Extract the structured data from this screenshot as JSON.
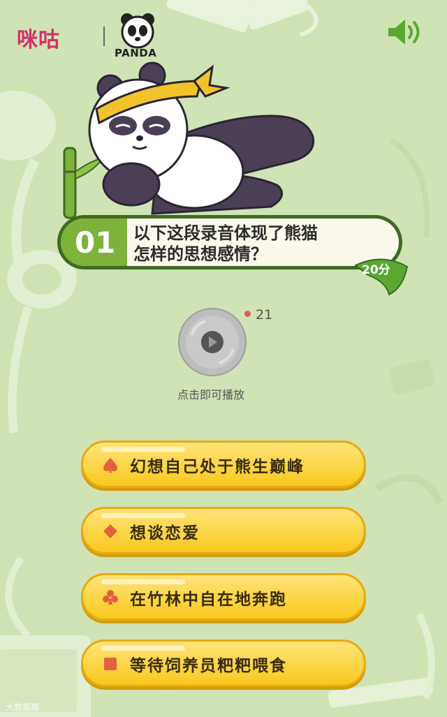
{
  "brand": {
    "migu": "咪咕",
    "panda": "PANDA"
  },
  "question": {
    "number": "01",
    "line1": "以下这段录音体现了熊猫",
    "line2": "怎样的思想感情？",
    "score": "20分"
  },
  "audio": {
    "countdown": "21",
    "hint": "点击即可播放"
  },
  "options": [
    {
      "suit": "spade-icon",
      "label": "幻想自己处于熊生巅峰"
    },
    {
      "suit": "diamond-icon",
      "label": "想谈恋爱"
    },
    {
      "suit": "club-icon",
      "label": "在竹林中自在地奔跑"
    },
    {
      "suit": "square-icon",
      "label": "等待饲养员粑粑喂食"
    }
  ],
  "watermark": "大数据猿",
  "colors": {
    "background": "#cfe3b4",
    "accent_green": "#7db23b",
    "option_yellow": "#f9c81e",
    "suit_red": "#e2603f"
  }
}
